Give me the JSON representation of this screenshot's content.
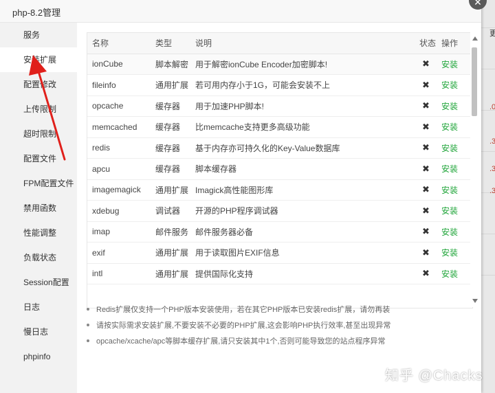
{
  "window": {
    "title": "php-8.2管理",
    "close_icon": "close-icon"
  },
  "sidebar": {
    "items": [
      {
        "label": "服务",
        "active": false
      },
      {
        "label": "安装扩展",
        "active": true
      },
      {
        "label": "配置修改",
        "active": false
      },
      {
        "label": "上传限制",
        "active": false
      },
      {
        "label": "超时限制",
        "active": false
      },
      {
        "label": "配置文件",
        "active": false
      },
      {
        "label": "FPM配置文件",
        "active": false
      },
      {
        "label": "禁用函数",
        "active": false
      },
      {
        "label": "性能调整",
        "active": false
      },
      {
        "label": "负载状态",
        "active": false
      },
      {
        "label": "Session配置",
        "active": false
      },
      {
        "label": "日志",
        "active": false
      },
      {
        "label": "慢日志",
        "active": false
      },
      {
        "label": "phpinfo",
        "active": false
      }
    ]
  },
  "table": {
    "headers": [
      "名称",
      "类型",
      "说明",
      "状态",
      "操作"
    ],
    "rows": [
      {
        "name": "ionCube",
        "type": "脚本解密",
        "desc": "用于解密ionCube Encoder加密脚本!",
        "status": "✖",
        "action": "安装"
      },
      {
        "name": "fileinfo",
        "type": "通用扩展",
        "desc": "若可用内存小于1G，可能会安装不上",
        "status": "✖",
        "action": "安装"
      },
      {
        "name": "opcache",
        "type": "缓存器",
        "desc": "用于加速PHP脚本!",
        "status": "✖",
        "action": "安装"
      },
      {
        "name": "memcached",
        "type": "缓存器",
        "desc": "比memcache支持更多高级功能",
        "status": "✖",
        "action": "安装"
      },
      {
        "name": "redis",
        "type": "缓存器",
        "desc": "基于内存亦可持久化的Key-Value数据库",
        "status": "✖",
        "action": "安装"
      },
      {
        "name": "apcu",
        "type": "缓存器",
        "desc": "脚本缓存器",
        "status": "✖",
        "action": "安装"
      },
      {
        "name": "imagemagick",
        "type": "通用扩展",
        "desc": "Imagick高性能图形库",
        "status": "✖",
        "action": "安装"
      },
      {
        "name": "xdebug",
        "type": "调试器",
        "desc": "开源的PHP程序调试器",
        "status": "✖",
        "action": "安装"
      },
      {
        "name": "imap",
        "type": "邮件服务",
        "desc": "邮件服务器必备",
        "status": "✖",
        "action": "安装"
      },
      {
        "name": "exif",
        "type": "通用扩展",
        "desc": "用于读取图片EXIF信息",
        "status": "✖",
        "action": "安装"
      },
      {
        "name": "intl",
        "type": "通用扩展",
        "desc": "提供国际化支持",
        "status": "✖",
        "action": "安装"
      }
    ]
  },
  "notes": [
    "Redis扩展仅支持一个PHP版本安装使用，若在其它PHP版本已安装redis扩展，请勿再装",
    "请按实际需求安装扩展,不要安装不必要的PHP扩展,这会影响PHP执行效率,甚至出现异常",
    "opcache/xcache/apc等脚本缓存扩展,请只安装其中1个,否则可能导致您的站点程序异常"
  ],
  "watermark": "知乎 @Chacks",
  "background_fragments": [
    "更",
    ".0",
    ".3",
    ".3",
    ".3"
  ],
  "colors": {
    "install_green": "#20a53a",
    "arrow_red": "#e0201b",
    "active_bg": "#ffffff",
    "sidebar_bg": "#f2f2f2"
  }
}
